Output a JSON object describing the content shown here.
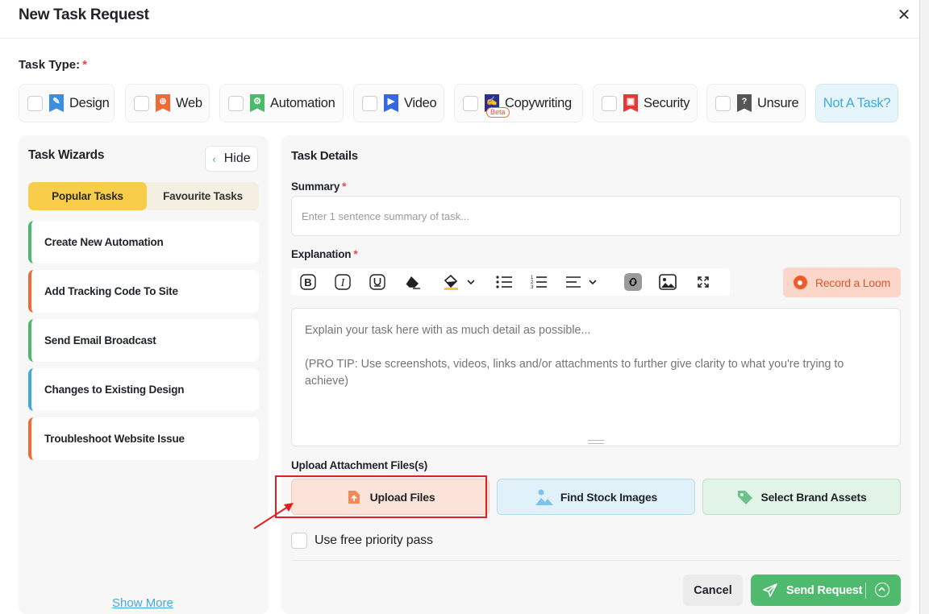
{
  "modal": {
    "title": "New Task Request"
  },
  "task_type": {
    "label": "Task Type:",
    "required_mark": "*",
    "options": [
      {
        "label": "Design",
        "icon": "pencil-icon",
        "color": "#3b8fe0"
      },
      {
        "label": "Web",
        "icon": "globe-icon",
        "color": "#ef6a35"
      },
      {
        "label": "Automation",
        "icon": "gear-icon",
        "color": "#4cba6a"
      },
      {
        "label": "Video",
        "icon": "video-camera-icon",
        "color": "#3567e0"
      },
      {
        "label": "Copywriting",
        "icon": "document-pen-icon",
        "color": "#2b2f8f",
        "badge": "Beta"
      },
      {
        "label": "Security",
        "icon": "lock-icon",
        "color": "#e53935"
      },
      {
        "label": "Unsure",
        "icon": "question-icon",
        "color": "#555555"
      }
    ],
    "not_a_task": "Not A Task?"
  },
  "wizards": {
    "title": "Task Wizards",
    "hide_label": "Hide",
    "tabs": [
      "Popular Tasks",
      "Favourite Tasks"
    ],
    "items": [
      {
        "label": "Create New Automation",
        "color": "#4cba6a"
      },
      {
        "label": "Add Tracking Code To Site",
        "color": "#ef6a35"
      },
      {
        "label": "Send Email Broadcast",
        "color": "#4cba6a"
      },
      {
        "label": "Changes to Existing Design",
        "color": "#43a8dd"
      },
      {
        "label": "Troubleshoot Website Issue",
        "color": "#ef6a35"
      }
    ],
    "show_more": "Show More"
  },
  "details": {
    "title": "Task Details",
    "summary_label": "Summary",
    "summary_placeholder": "Enter 1 sentence summary of task...",
    "explanation_label": "Explanation",
    "required_mark": "*",
    "record_loom": "Record a Loom",
    "explanation_placeholder": "Explain your task here with as much detail as possible...\n\n(PRO TIP: Use screenshots, videos, links and/or attachments to further give clarity to what you're trying to achieve)",
    "upload_label": "Upload Attachment Files(s)",
    "upload_files": "Upload Files",
    "find_stock": "Find Stock Images",
    "brand_assets": "Select Brand Assets",
    "priority_pass": "Use free priority pass",
    "cancel": "Cancel",
    "send": "Send Request"
  },
  "colors": {
    "accent_yellow": "#f8cd4a",
    "accent_blue": "#43a8dd",
    "accent_green": "#4fba6e",
    "highlight_red": "#e02020"
  }
}
